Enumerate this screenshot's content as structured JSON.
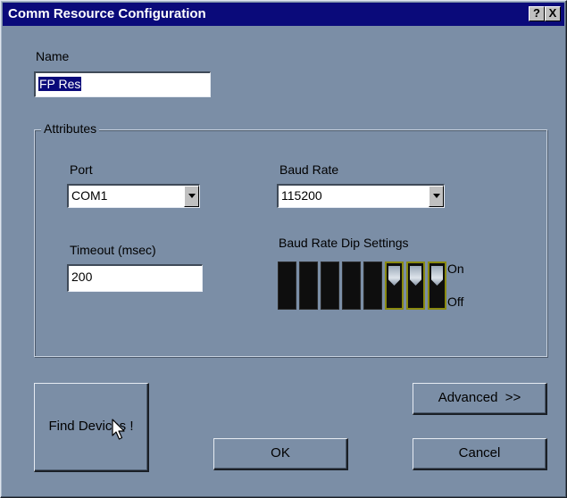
{
  "window": {
    "title": "Comm Resource Configuration",
    "help_button": "?",
    "close_button": "X"
  },
  "name": {
    "label": "Name",
    "value": "FP Res"
  },
  "attributes": {
    "group_label": "Attributes",
    "port": {
      "label": "Port",
      "value": "COM1"
    },
    "baud_rate": {
      "label": "Baud Rate",
      "value": "115200"
    },
    "timeout": {
      "label": "Timeout (msec)",
      "value": "200"
    },
    "dip": {
      "label": "Baud Rate Dip Settings",
      "on_label": "On",
      "off_label": "Off",
      "switches": [
        false,
        false,
        false,
        false,
        false,
        true,
        true,
        true
      ]
    }
  },
  "buttons": {
    "find_devices": "Find Devices !",
    "advanced": "Advanced  >>",
    "ok": "OK",
    "cancel": "Cancel"
  }
}
